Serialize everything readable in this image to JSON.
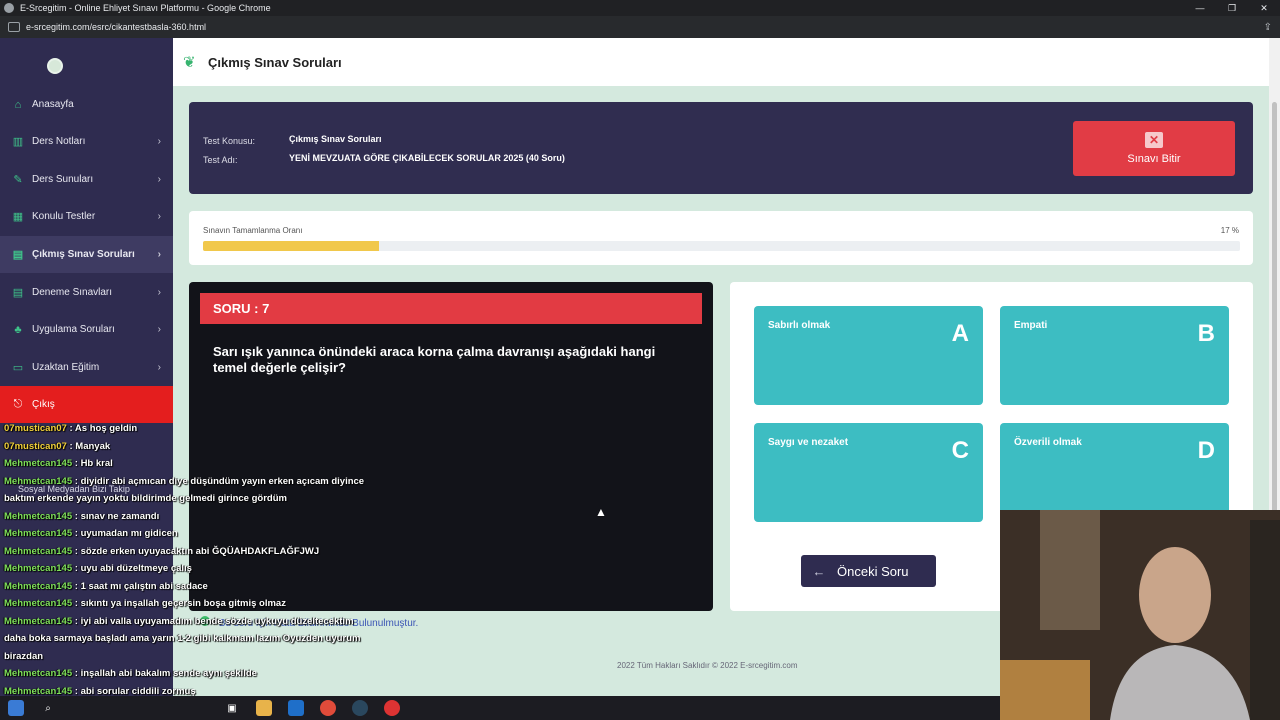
{
  "browser": {
    "window_title": "E-Srcegitim - Online Ehliyet Sınavı Platformu - Google Chrome",
    "url": "e-srcegitim.com/esrc/cikantestbasla-360.html",
    "controls": {
      "minimize": "—",
      "restore": "❐",
      "close": "✕"
    }
  },
  "sidebar": {
    "items": [
      {
        "label": "Anasayfa",
        "icon": "home-icon",
        "glyph": "⌂",
        "has_chevron": false
      },
      {
        "label": "Ders Notları",
        "icon": "book-icon",
        "glyph": "▥",
        "has_chevron": true
      },
      {
        "label": "Ders Sunuları",
        "icon": "presentation-icon",
        "glyph": "✎",
        "has_chevron": true
      },
      {
        "label": "Konulu Testler",
        "icon": "building-icon",
        "glyph": "▦",
        "has_chevron": true
      },
      {
        "label": "Çıkmış Sınav Soruları",
        "icon": "clipboard-icon",
        "glyph": "▤",
        "has_chevron": true
      },
      {
        "label": "Deneme Sınavları",
        "icon": "list-icon",
        "glyph": "▤",
        "has_chevron": true
      },
      {
        "label": "Uygulama Soruları",
        "icon": "users-icon",
        "glyph": "♣",
        "has_chevron": true
      },
      {
        "label": "Uzaktan Eğitim",
        "icon": "monitor-icon",
        "glyph": "▭",
        "has_chevron": true
      },
      {
        "label": "Çıkış",
        "icon": "exit-icon",
        "glyph": "⎋",
        "has_chevron": false
      }
    ],
    "chevron": "›",
    "social_title": "Sosyal Medyadan Bizi Takip"
  },
  "header": {
    "title": "Çıkmış Sınav Soruları"
  },
  "test_info": {
    "topic_label": "Test Konusu:",
    "topic_value": "Çıkmış Sınav Soruları",
    "name_label": "Test Adı:",
    "name_value": "YENİ MEVZUATA GÖRE ÇIKABİLECEK SORULAR 2025 (40 Soru)",
    "finish_label": "Sınavı Bitir"
  },
  "progress": {
    "label": "Sınavın Tamamlanma Oranı",
    "percent_text": "17 %",
    "fraction": 0.17
  },
  "question": {
    "number_label": "SORU : 7",
    "text": "Sarı ışık yanınca önündeki araca korna çalma davranışı aşağıdaki hangi temel değerle çelişir?"
  },
  "options": [
    {
      "letter": "A",
      "text": "Sabırlı olmak"
    },
    {
      "letter": "B",
      "text": "Empati"
    },
    {
      "letter": "C",
      "text": "Saygı ve nezaket"
    },
    {
      "letter": "D",
      "text": "Özverili olmak"
    }
  ],
  "prev_button": "Önceki Soru",
  "report_text": "Bu soru için Hata Bildiriminde Bulunulmuştur.",
  "footer": "2022 Tüm Hakları Saklıdır © 2022 E-srcegitim.com",
  "chat": [
    {
      "user": "07mustican07",
      "msg": " : As hoş geldin",
      "alt": true
    },
    {
      "user": "07mustican07",
      "msg": " : Manyak",
      "alt": true
    },
    {
      "user": "Mehmetcan145",
      "msg": " : Hb kral",
      "alt": false
    },
    {
      "user": "Mehmetcan145",
      "msg": " : diyidir abi açmıcan diye düşündüm yayın erken açıcam diyince",
      "alt": false
    },
    {
      "user": "",
      "msg": "baktım erkende yayın yoktu bildirimde gelmedi girince gördüm",
      "alt": false
    },
    {
      "user": "Mehmetcan145",
      "msg": " : sınav ne zamandı",
      "alt": false
    },
    {
      "user": "Mehmetcan145",
      "msg": " : uyumadan mı gidicen",
      "alt": false
    },
    {
      "user": "Mehmetcan145",
      "msg": " : sözde erken uyuyacaktın abi ĞQÜAHDAKFLAĞFJWJ",
      "alt": false
    },
    {
      "user": "Mehmetcan145",
      "msg": " : uyu abi düzeltmeye çalış",
      "alt": false
    },
    {
      "user": "Mehmetcan145",
      "msg": " : 1 saat mı çalıştın abi sadace",
      "alt": false
    },
    {
      "user": "Mehmetcan145",
      "msg": " : sıkıntı ya inşallah geçersin boşa gitmiş olmaz",
      "alt": false
    },
    {
      "user": "Mehmetcan145",
      "msg": " : iyi abi valla uyuyamadım bende sözde uykuyu düzeltecektim",
      "alt": false
    },
    {
      "user": "",
      "msg": "daha boka sarmaya başladı ama yarın 1-2 gibi kalkmam lazım Oyuzden uyurum",
      "alt": false
    },
    {
      "user": "",
      "msg": "birazdan",
      "alt": false
    },
    {
      "user": "Mehmetcan145",
      "msg": " : inşallah abi bakalım sende aynı şekilde",
      "alt": false
    },
    {
      "user": "Mehmetcan145",
      "msg": " : abi sorular ciddili zormuş",
      "alt": false
    }
  ],
  "colors": {
    "sidebar_bg": "#2f2c50",
    "accent_red": "#e23b43",
    "option_teal": "#3dbdc2",
    "progress_yellow": "#f1c84b",
    "page_bg": "#d4e9de"
  }
}
